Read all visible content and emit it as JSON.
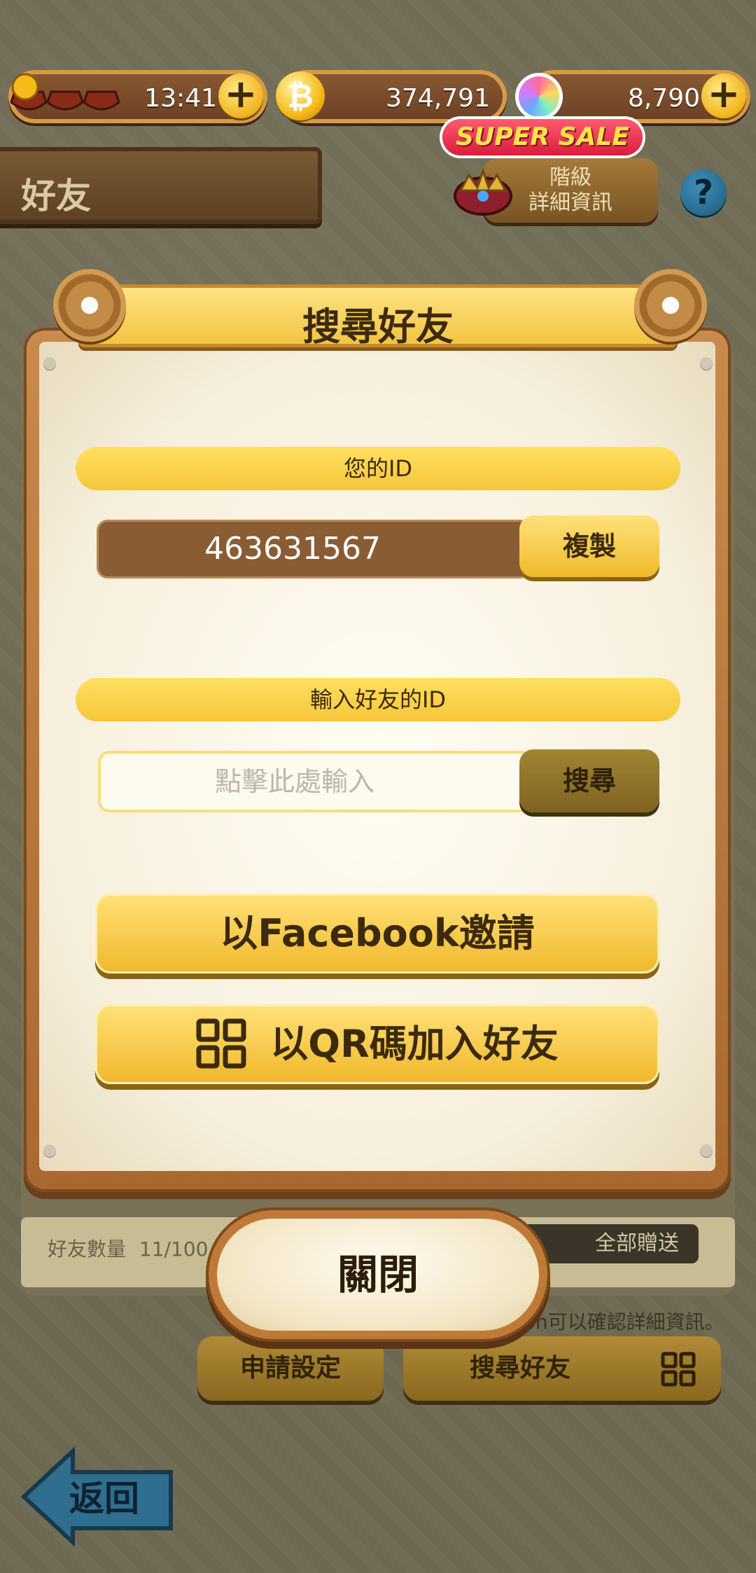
{
  "top_bar": {
    "stamina_time": "13:41",
    "coins": "374,791",
    "gems": "8,790",
    "coin_symbol": "₿",
    "sale_banner": "SUPER SALE"
  },
  "header": {
    "page_title": "好友",
    "rank_button_line1": "階級",
    "rank_button_line2": "詳細資訊",
    "help_symbol": "?"
  },
  "modal": {
    "title": "搜尋好友",
    "your_id_label": "您的ID",
    "your_id_value": "463631567",
    "copy_label": "複製",
    "enter_id_label": "輸入好友的ID",
    "input_placeholder": "點擊此處輸入",
    "search_label": "搜尋",
    "facebook_invite_label": "以Facebook邀請",
    "qr_add_label": "以QR碼加入好友",
    "close_label": "關閉"
  },
  "background_panel": {
    "friend_count_label": "好友數量",
    "friend_count_value": "11/100",
    "gift_all_label": "全部贈送",
    "tip_text": "bon可以確認詳細資訊。",
    "request_settings_label": "申請設定",
    "search_friend_label": "搜尋好友",
    "back_label": "返回"
  },
  "colors": {
    "accent_yellow": "#f4c63a",
    "wood_brown": "#a8682f",
    "paper": "#fffdf4",
    "background": "#6f6a52"
  }
}
